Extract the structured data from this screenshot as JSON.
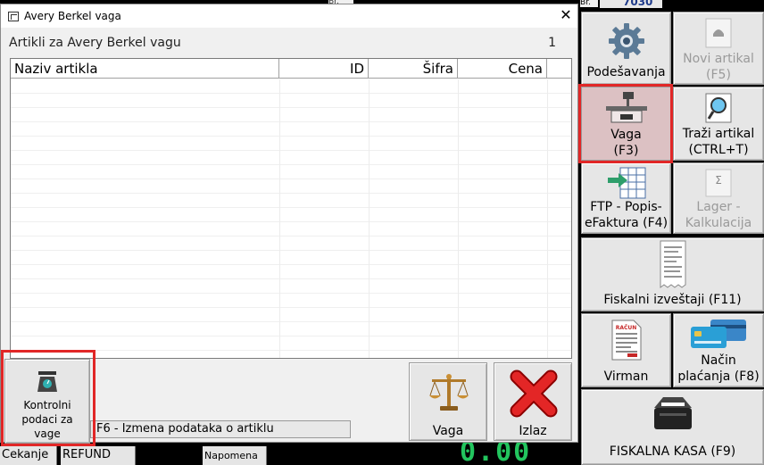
{
  "background": {
    "counter": "7030",
    "br_label": "Br.",
    "top_label": "Br.",
    "status": {
      "cekanje": "Cekanje",
      "refund": "REFUND",
      "napomena": "Napomena"
    },
    "green_display": "0.00"
  },
  "panel": {
    "podesavanja": "Podešavanja",
    "novi_artikal": [
      "Novi artikal",
      "(F5)"
    ],
    "vaga": [
      "Vaga",
      "(F3)"
    ],
    "trazi_artikal": [
      "Traži artikal",
      "(CTRL+T)"
    ],
    "ftp": [
      "FTP - Popis-",
      "eFaktura (F4)"
    ],
    "lager": [
      "Lager -",
      "Kalkulacija"
    ],
    "fiskalni_izvestaji": "Fiskalni izveštaji (F11)",
    "virman": "Virman",
    "nacin_placanja": [
      "Način",
      "plaćanja (F8)"
    ],
    "fiskalna_kasa": "FISKALNA KASA (F9)",
    "receipt_label": "RAČUN",
    "lager_symbol": "Σ"
  },
  "dialog": {
    "title": "Avery Berkel vaga",
    "close_glyph": "✕",
    "list_heading": "Artikli za Avery Berkel vagu",
    "count": "1",
    "columns": {
      "naziv": "Naziv artikla",
      "id": "ID",
      "sifra": "Šifra",
      "cena": "Cena"
    },
    "status_text": "F6 - Izmena podataka o artiklu",
    "buttons": {
      "kontrolni": [
        "Kontrolni",
        "podaci za",
        "vage"
      ],
      "vaga": "Vaga",
      "izlaz": "Izlaz"
    }
  },
  "colors": {
    "highlight": "#e12727",
    "selected_button": "#dcc1c3",
    "green_display": "#22c55e"
  }
}
